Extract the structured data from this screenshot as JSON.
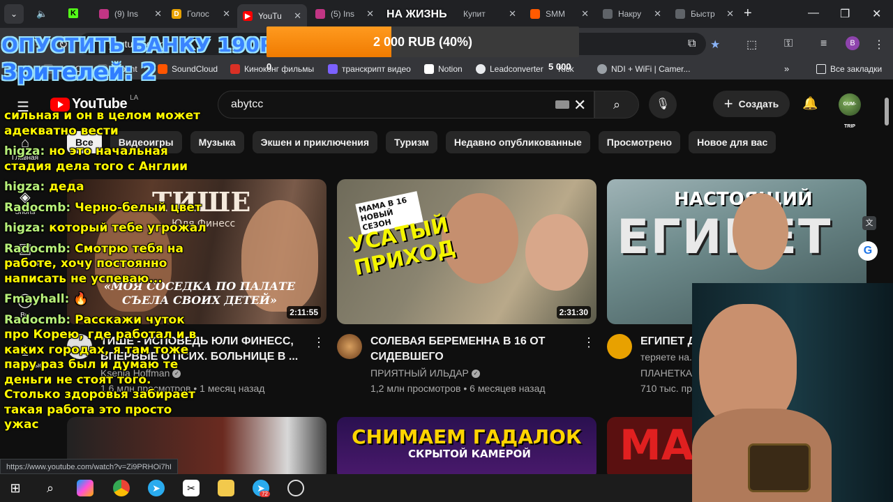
{
  "tabs": [
    {
      "label": "(9) Ins",
      "color": "#c13584"
    },
    {
      "label": "Голос",
      "color": "#e8a200"
    },
    {
      "label": "YouTu",
      "color": "#ff0000"
    },
    {
      "label": "(5) Ins",
      "color": "#c13584"
    },
    {
      "label": "Купит",
      "color": "#888888"
    },
    {
      "label": "SMM",
      "color": "#ff5a00"
    },
    {
      "label": "Накру",
      "color": "#3a3a3a"
    },
    {
      "label": "Быстр",
      "color": "#3a3a3a"
    }
  ],
  "address": "youtube.com",
  "profile_initial": "B",
  "bookmarks": [
    {
      "label": "СлМО"
    },
    {
      "label": "Imprint"
    },
    {
      "label": "SoundCloud"
    },
    {
      "label": "Киноконг фильмы"
    },
    {
      "label": "транскрипт видео"
    },
    {
      "label": "Notion"
    },
    {
      "label": "Leadconverter"
    },
    {
      "label": "Kick"
    },
    {
      "label": "NDI + WiFi | Camer..."
    },
    {
      "label": "Все закладки"
    }
  ],
  "youtube": {
    "region": "LA",
    "search_value": "abytcc",
    "create_label": "Создать",
    "account_label": "GUM-TRIP",
    "chips": [
      "Все",
      "Видеоигры",
      "Музыка",
      "Экшен и приключения",
      "Туризм",
      "Недавно опубликованные",
      "Просмотрено",
      "Новое для вас"
    ],
    "guide": [
      "Главная",
      "Shorts",
      "Подписки",
      "Вы",
      "Скачанные"
    ],
    "videos": [
      {
        "thumb_title": "ТИШЕ",
        "thumb_sub": "Юля Финесс",
        "thumb_caption": "«МОЯ СОСЕДКА ПО ПАЛАТЕ СЪЕЛА СВОИХ ДЕТЕЙ»",
        "duration": "2:11:55",
        "title": "ТИШЕ - ИСПОВЕДЬ ЮЛИ ФИНЕСС, ВПЕРВЫЕ О ПСИХ. БОЛЬНИЦЕ В ...",
        "channel": "Ksenia Hoffman",
        "views": "1,6 млн просмотров",
        "age": "1 месяц назад"
      },
      {
        "thumb_title": "УСАТЫЙ ПРИХОД",
        "thumb_sub": "МАМА В 16 НОВЫЙ СЕЗОН",
        "duration": "2:31:30",
        "title": "СОЛЕВАЯ БЕРЕМЕННА В 16 ОТ СИДЕВШЕГО",
        "channel": "ПРИЯТНЫЙ ИЛЬДАР",
        "views": "1,2 млн просмотров",
        "age": "6 месяцев назад"
      },
      {
        "thumb_title": "ЕГИПЕТ",
        "thumb_sub": "НАСТОЯЩИЙ",
        "title": "ЕГИПЕТ Д...",
        "title_line2": "теряете на...",
        "channel": "ПЛАНЕТКА",
        "views": "710 тыс. пр..."
      },
      {
        "thumb_title": ""
      },
      {
        "thumb_title": "СНИМАЕМ ГАДАЛОК",
        "thumb_sub": "СКРЫТОЙ КАМЕРОЙ"
      },
      {
        "thumb_title": "МА"
      }
    ]
  },
  "status_url": "https://www.youtube.com/watch?v=Zi9PRHOi7hI",
  "overlay": {
    "goal_text": "ОПУСТИТЬ БАНКУ 190Р",
    "viewers_text": "Зрителей: 2",
    "campaign": "НА ЖИЗНЬ",
    "bar_text": "2 000 RUB (40%)",
    "bar_progress": 0.4,
    "bar_min": "0",
    "bar_max": "5 000"
  },
  "chat": [
    {
      "user": "",
      "text": "сильная и он в целом может адекватно вести"
    },
    {
      "user": "higza:",
      "text": "но это начальная стадия дела того с Англии"
    },
    {
      "user": "higza:",
      "text": "деда"
    },
    {
      "user": "Radocmb:",
      "text": "Черно-белый цвет"
    },
    {
      "user": "higza:",
      "text": "который тебе угрожал"
    },
    {
      "user": "Radocmb:",
      "text": "Смотрю тебя на работе, хочу постоянно написать не успеваю..."
    },
    {
      "user": "Fmayhall:",
      "text": "🔥"
    },
    {
      "user": "Radocmb:",
      "text": "Расскажи чуток про Корею, где работал и в каких городах, я там тоже пару раз был и думаю те деньги не стоят того. Столько здоровья забирает такая работа это просто ужас"
    }
  ],
  "taskbar_badge": "72"
}
